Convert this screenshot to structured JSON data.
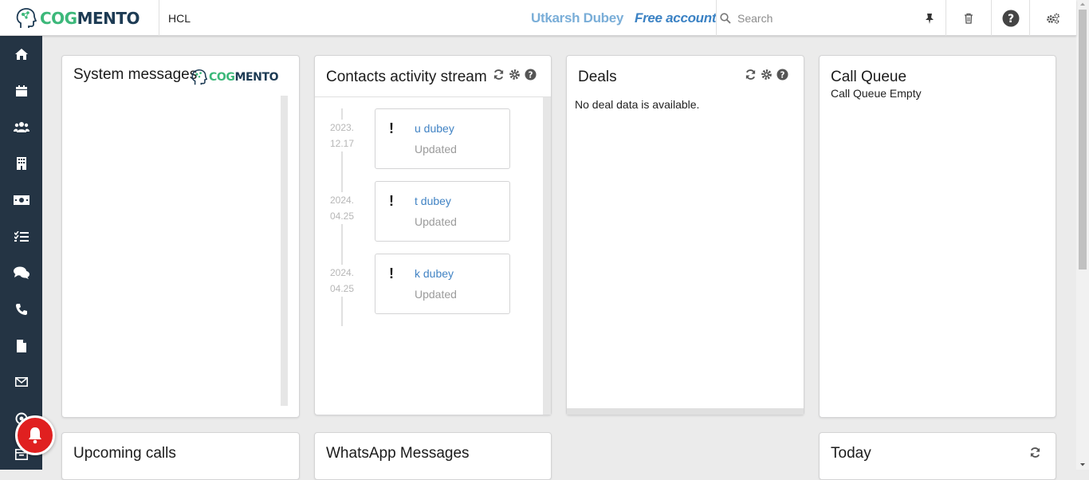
{
  "header": {
    "logo_text_green": "COG",
    "logo_text_dark": "MENTO",
    "company": "HCL",
    "user_name": "Utkarsh Dubey",
    "account_type": "Free account",
    "search_placeholder": "Search"
  },
  "sidebar": {
    "items": [
      "home-icon",
      "calendar-icon",
      "users-icon",
      "building-icon",
      "money-icon",
      "tasks-icon",
      "comments-icon",
      "phone-icon",
      "document-icon",
      "envelope-icon",
      "target-icon",
      "archive-icon"
    ]
  },
  "cards": {
    "system_messages": {
      "title": "System messages",
      "logo_green": "COG",
      "logo_dark": "MENTO"
    },
    "contacts_stream": {
      "title": "Contacts activity stream",
      "entries": [
        {
          "date_year": "2023.",
          "date_md": "12.17",
          "name": "u dubey",
          "status": "Updated"
        },
        {
          "date_year": "2024.",
          "date_md": "04.25",
          "name": "t dubey",
          "status": "Updated"
        },
        {
          "date_year": "2024.",
          "date_md": "04.25",
          "name": "k dubey",
          "status": "Updated"
        }
      ]
    },
    "deals": {
      "title": "Deals",
      "empty_text": "No deal data is available."
    },
    "call_queue": {
      "title": "Call Queue",
      "empty_text": "Call Queue Empty"
    },
    "upcoming_calls": {
      "title": "Upcoming calls"
    },
    "whatsapp": {
      "title": "WhatsApp Messages"
    },
    "today": {
      "title": "Today"
    }
  },
  "colors": {
    "brand_green": "#3cb87a",
    "brand_dark": "#1d3b54",
    "sidebar": "#243444",
    "link": "#4183c4",
    "notification_red": "#e02020"
  }
}
